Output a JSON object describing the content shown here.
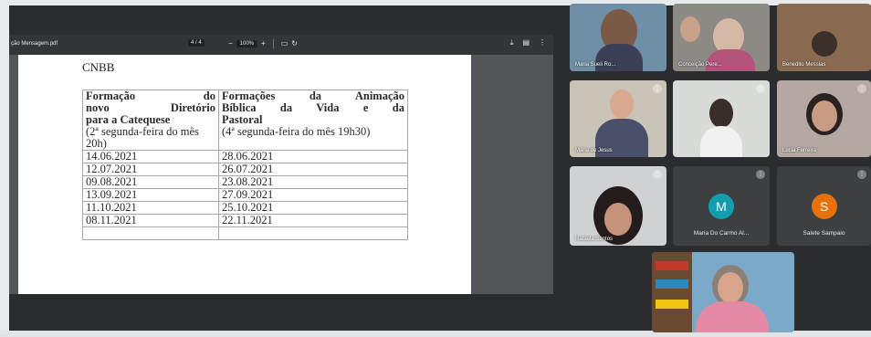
{
  "pdf_viewer": {
    "file_name": "ção Mensagem.pdf",
    "page_field": "4 / 4",
    "zoom_value": "100%",
    "page": {
      "heading": "CNBB",
      "table": {
        "col1_header_lines": [
          "Formação do",
          "novo Diretório",
          "para a Catequese"
        ],
        "col1_note": "(2ª segunda-feira do mês 20h)",
        "col2_header_lines": [
          "Formações da Animação",
          "Bíblica da Vida e da",
          "Pastoral"
        ],
        "col2_note": "(4ª segunda-feira do mês 19h30)",
        "rows": [
          [
            "14.06.2021",
            "28.06.2021"
          ],
          [
            "12.07.2021",
            "26.07.2021"
          ],
          [
            "09.08.2021",
            "23.08.2021"
          ],
          [
            "13.09.2021",
            "27.09.2021"
          ],
          [
            "11.10.2021",
            "25.10.2021"
          ],
          [
            "08.11.2021",
            "22.11.2021"
          ]
        ]
      }
    }
  },
  "participants": {
    "tiles": [
      {
        "name": "Maria Sueli Ro..."
      },
      {
        "name": "Conceição Pere..."
      },
      {
        "name": "Benedito Messias"
      },
      {
        "name": "Maria de Jesus"
      },
      {
        "name": ""
      },
      {
        "name": "Lucia Ferreira"
      },
      {
        "name": "Rafaela Santos"
      },
      {
        "name": "Maria Do Carmo Al...",
        "initial": "M",
        "avatar_color": "#129eaf"
      },
      {
        "name": "Salete Sampaio",
        "initial": "S",
        "avatar_color": "#e8710a"
      },
      {
        "name": ""
      }
    ]
  },
  "colors": {
    "meeting_bg": "#2b2c2f",
    "viewer_bg": "#525659",
    "toolbar_bg": "#323639"
  }
}
